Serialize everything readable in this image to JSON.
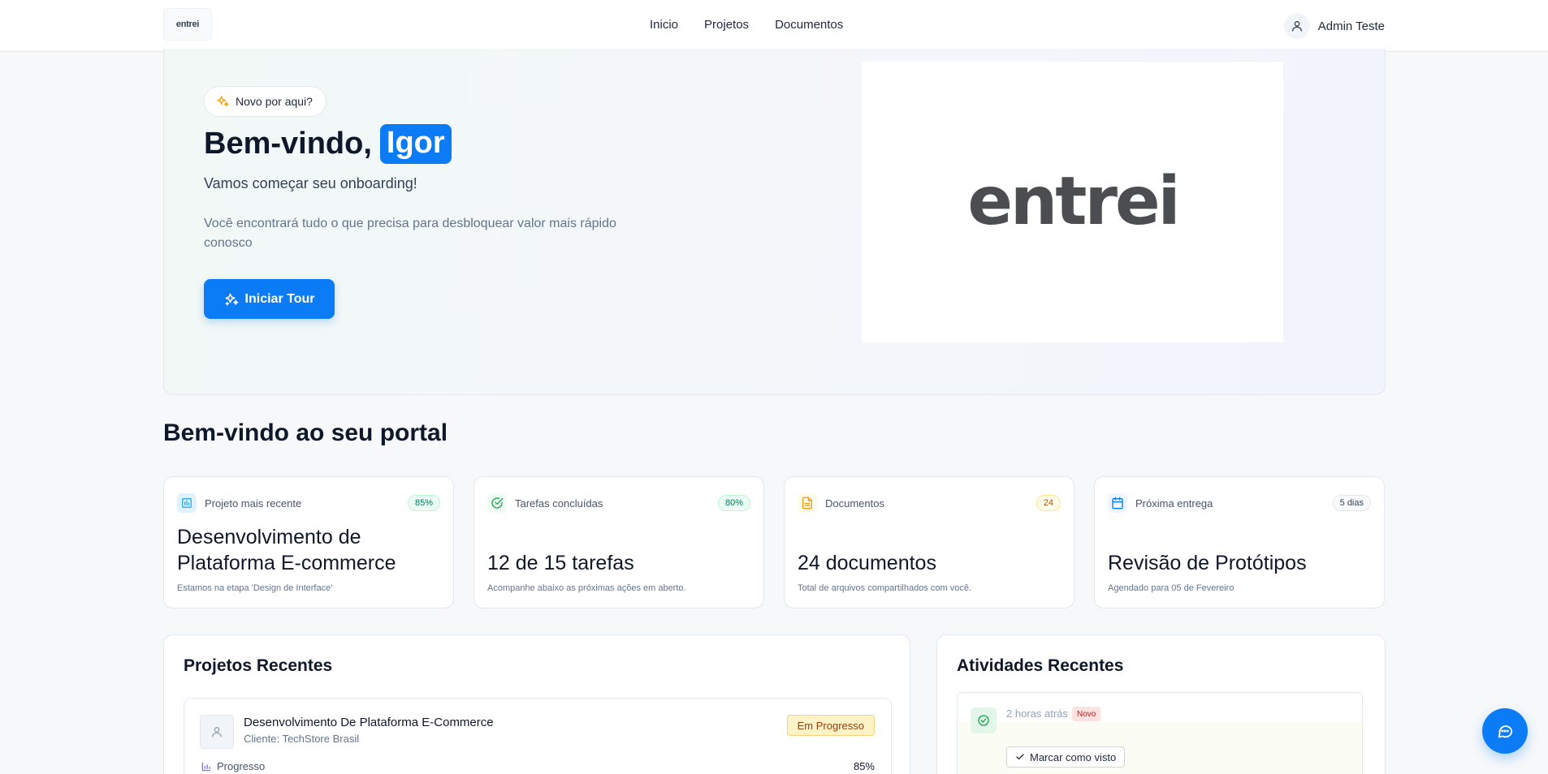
{
  "header": {
    "logo_text": "entrei",
    "nav": [
      {
        "label": "Inicio"
      },
      {
        "label": "Projetos"
      },
      {
        "label": "Documentos"
      }
    ],
    "user_name": "Admin Teste"
  },
  "hero": {
    "badge": "Novo por aqui?",
    "title_prefix": "Bem-vindo,",
    "user_first_name": "Igor",
    "subtitle": "Vamos começar seu onboarding!",
    "description": "Você encontrará tudo o que precisa para desbloquear valor mais rápido conosco",
    "cta_label": "Iniciar Tour",
    "image_logo_text": "entrei"
  },
  "section_title": "Bem-vindo ao seu portal",
  "stats": [
    {
      "icon": "project-icon",
      "label": "Projeto mais recente",
      "badge": "85%",
      "value": "Desenvolvimento de Plataforma E-commerce",
      "note": "Estamos na etapa 'Design de Interface'",
      "accent": "#0ea5e9"
    },
    {
      "icon": "check-circle-icon",
      "label": "Tarefas concluídas",
      "badge": "80%",
      "value": "12 de 15 tarefas",
      "note": "Acompanhe abaixo as próximas ações em aberto.",
      "accent": "#16a34a"
    },
    {
      "icon": "document-icon",
      "label": "Documentos",
      "badge": "24",
      "value": "24 documentos",
      "note": "Total de arquivos compartilhados com você.",
      "accent": "#f59e0b"
    },
    {
      "icon": "calendar-icon",
      "label": "Próxima entrega",
      "badge": "5 dias",
      "value": "Revisão de Protótipos",
      "note": "Agendado para 05 de Fevereiro",
      "accent": "#0b7cf5"
    }
  ],
  "recent_projects": {
    "title": "Projetos Recentes",
    "items": [
      {
        "name": "Desenvolvimento De Plataforma E-Commerce",
        "client": "Cliente: TechStore Brasil",
        "status": "Em Progresso",
        "progress_label": "Progresso",
        "progress": "85%"
      }
    ]
  },
  "recent_activities": {
    "title": "Atividades Recentes",
    "items": [
      {
        "time": "2 horas atrás",
        "tag": "Novo",
        "action_label": "Marcar como visto"
      }
    ]
  },
  "colors": {
    "primary": "#0b7cf5",
    "text": "#0f172a",
    "muted": "#64748b"
  }
}
